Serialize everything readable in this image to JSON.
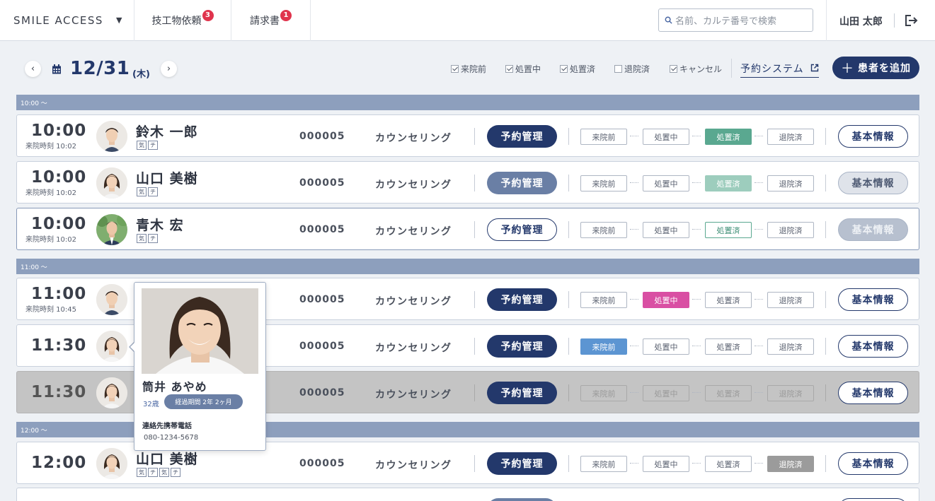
{
  "header": {
    "brand": "SMILE ACCESS",
    "nav": [
      {
        "label": "技工物依頼",
        "badge": "3"
      },
      {
        "label": "請求書",
        "badge": "1"
      }
    ],
    "search_placeholder": "名前、カルテ番号で検索",
    "user_name": "山田 太郎"
  },
  "datebar": {
    "date": "12/31",
    "dow": "(木)",
    "filters": [
      {
        "label": "来院前",
        "checked": true
      },
      {
        "label": "処置中",
        "checked": true
      },
      {
        "label": "処置済",
        "checked": true
      },
      {
        "label": "退院済",
        "checked": false
      },
      {
        "label": "キャンセル",
        "checked": true
      }
    ],
    "system_link": "予約システム",
    "add_button": "患者を追加"
  },
  "sections": [
    "10:00 〜",
    "11:00 〜",
    "12:00 〜"
  ],
  "labels": {
    "yoyaku": "予約管理",
    "kihon": "基本情報",
    "status": [
      "来院前",
      "処置中",
      "処置済",
      "退院済"
    ]
  },
  "rows": [
    {
      "time": "10:00",
      "arrival": "来院時刻 10:02",
      "name": "鈴木 一郎",
      "tags": [
        "気",
        "チ"
      ],
      "id": "000005",
      "type": "カウンセリング"
    },
    {
      "time": "10:00",
      "arrival": "来院時刻 10:02",
      "name": "山口 美樹",
      "tags": [
        "気",
        "チ"
      ],
      "id": "000005",
      "type": "カウンセリング"
    },
    {
      "time": "10:00",
      "arrival": "来院時刻 10:02",
      "name": "青木 宏",
      "tags": [
        "気",
        "チ"
      ],
      "id": "000005",
      "type": "カウンセリング"
    },
    {
      "time": "11:00",
      "arrival": "来院時刻 10:45",
      "name": "",
      "tags": [],
      "id": "000005",
      "type": "カウンセリング"
    },
    {
      "time": "11:30",
      "arrival": "",
      "name": "",
      "tags": [],
      "id": "000005",
      "type": "カウンセリング"
    },
    {
      "time": "11:30",
      "arrival": "",
      "name": "",
      "tags": [],
      "id": "000005",
      "type": "カウンセリング"
    },
    {
      "time": "12:00",
      "arrival": "",
      "name": "山口 美樹",
      "tags": [
        "気",
        "チ",
        "気",
        "チ"
      ],
      "id": "000005",
      "type": "カウンセリング"
    }
  ],
  "popup": {
    "name": "筒井 あやめ",
    "age": "32歳",
    "period": "経過期間 2年 2ヶ月",
    "contact_label": "連絡先携帯電話",
    "phone": "080-1234-5678"
  },
  "colors": {
    "navy": "#23386b",
    "green": "#5aa890",
    "pink": "#d94fa3",
    "blue": "#5c95d2",
    "gray": "#9b9b9b",
    "badge_red": "#e0344d"
  }
}
